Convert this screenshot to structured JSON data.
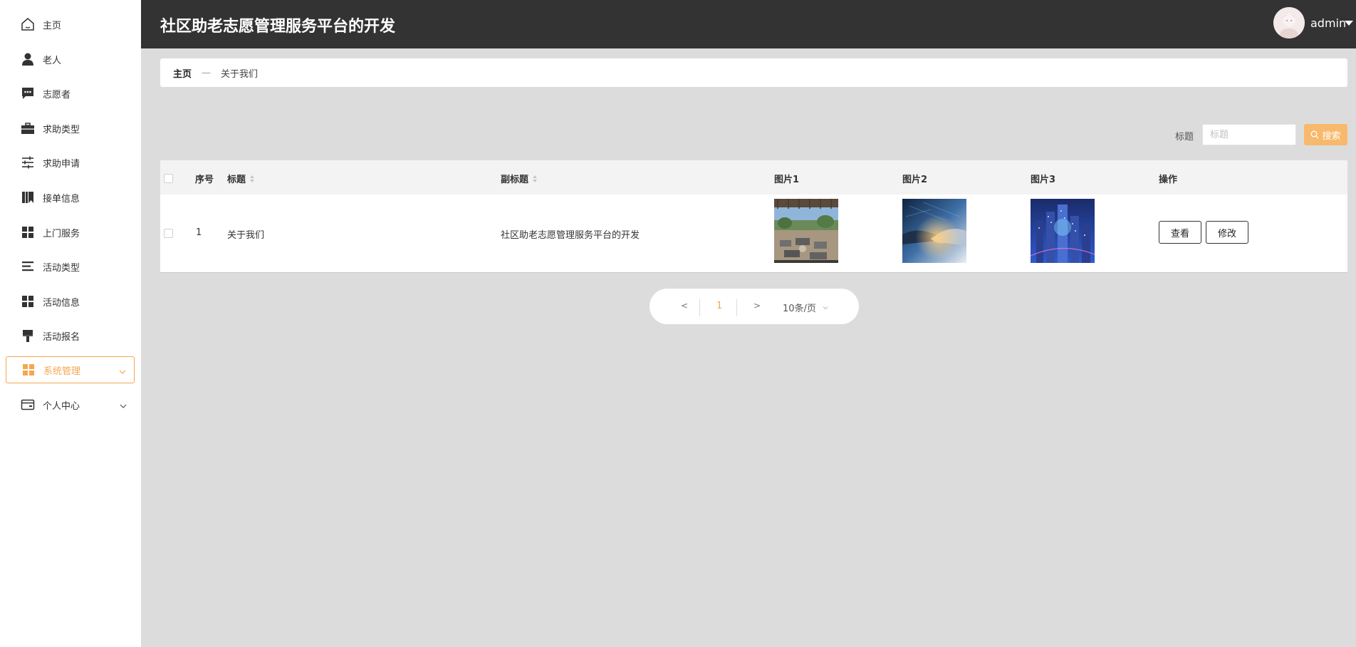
{
  "header": {
    "title": "社区助老志愿管理服务平台的开发",
    "username": "admin"
  },
  "sidebar": {
    "items": [
      {
        "label": "主页",
        "icon": "home-icon"
      },
      {
        "label": "老人",
        "icon": "person-icon"
      },
      {
        "label": "志愿者",
        "icon": "chat-icon"
      },
      {
        "label": "求助类型",
        "icon": "briefcase-icon"
      },
      {
        "label": "求助申请",
        "icon": "sliders-icon"
      },
      {
        "label": "接单信息",
        "icon": "bookmark-icon"
      },
      {
        "label": "上门服务",
        "icon": "grid-icon"
      },
      {
        "label": "活动类型",
        "icon": "list-icon"
      },
      {
        "label": "活动信息",
        "icon": "grid-icon"
      },
      {
        "label": "活动报名",
        "icon": "brush-icon"
      },
      {
        "label": "系统管理",
        "icon": "grid-icon",
        "active": true
      },
      {
        "label": "个人中心",
        "icon": "card-icon"
      }
    ],
    "accent_color": "#f5a74e"
  },
  "breadcrumb": {
    "home": "主页",
    "separator": "—",
    "current": "关于我们"
  },
  "search": {
    "label": "标题",
    "placeholder": "标题",
    "button_label": "搜索"
  },
  "table": {
    "columns": [
      "序号",
      "标题",
      "副标题",
      "图片1",
      "图片2",
      "图片3",
      "操作"
    ],
    "rows": [
      {
        "index": "1",
        "title": "关于我们",
        "subtitle": "社区助老志愿管理服务平台的开发",
        "images": [
          "terrace-photo",
          "handshake-photo",
          "city-lights-photo"
        ],
        "actions": [
          "查看",
          "修改"
        ]
      }
    ]
  },
  "pagination": {
    "prev": "<",
    "current_page": "1",
    "next": ">",
    "page_size": "10条/页"
  }
}
